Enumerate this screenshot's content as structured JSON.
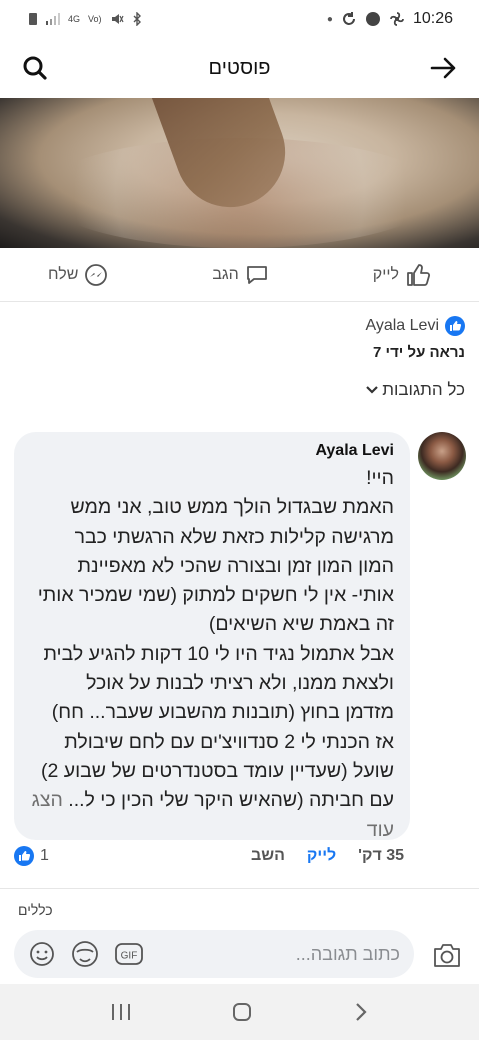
{
  "status_bar": {
    "left_icons": [
      "sim-icon",
      "signal-icon",
      "4g-icon",
      "volte-icon",
      "mute-icon",
      "bluetooth-icon"
    ],
    "right_icons": [
      "dot",
      "sync-icon",
      "app-icon",
      "fan-icon"
    ],
    "time": "10:26"
  },
  "header": {
    "title": "פוסטים"
  },
  "actions": {
    "like": "לייק",
    "comment": "הגב",
    "share": "שלח"
  },
  "liked_by": "Ayala Levi",
  "seen_by": "נראה על ידי 7",
  "all_replies": "כל התגובות",
  "comment": {
    "author": "Ayala Levi",
    "lines": [
      "היי!",
      "האמת שבגדול הולך ממש טוב, אני ממש",
      "מרגישה קלילות כזאת שלא הרגשתי כבר",
      "המון המון זמן ובצורה שהכי לא מאפיינת",
      "אותי- אין לי חשקים למתוק (שמי שמכיר אותי",
      "זה באמת שיא השיאים)",
      "אבל אתמול נגיד היו לי 10 דקות להגיע לבית",
      "ולצאת ממנו, ולא רציתי לבנות על אוכל",
      "מזדמן בחוץ (תובנות מהשבוע שעבר... חח)",
      "אז הכנתי לי 2 סנדוויצ'ים עם לחם שיבולת",
      "שועל (שעדיין עומד בסטנדרטים של שבוע 2)",
      "עם חביתה (שהאיש היקר שלי הכין כי ל... "
    ],
    "more_a": "הצג",
    "more_b": "עוד",
    "time": "35 דק'",
    "like": "לייק",
    "reply": "השב",
    "reaction_count": "1"
  },
  "rules": "כללים",
  "composer": {
    "placeholder": "כתוב תגובה..."
  },
  "colors": {
    "accent": "#1877f2",
    "bubble": "#f0f2f5"
  }
}
